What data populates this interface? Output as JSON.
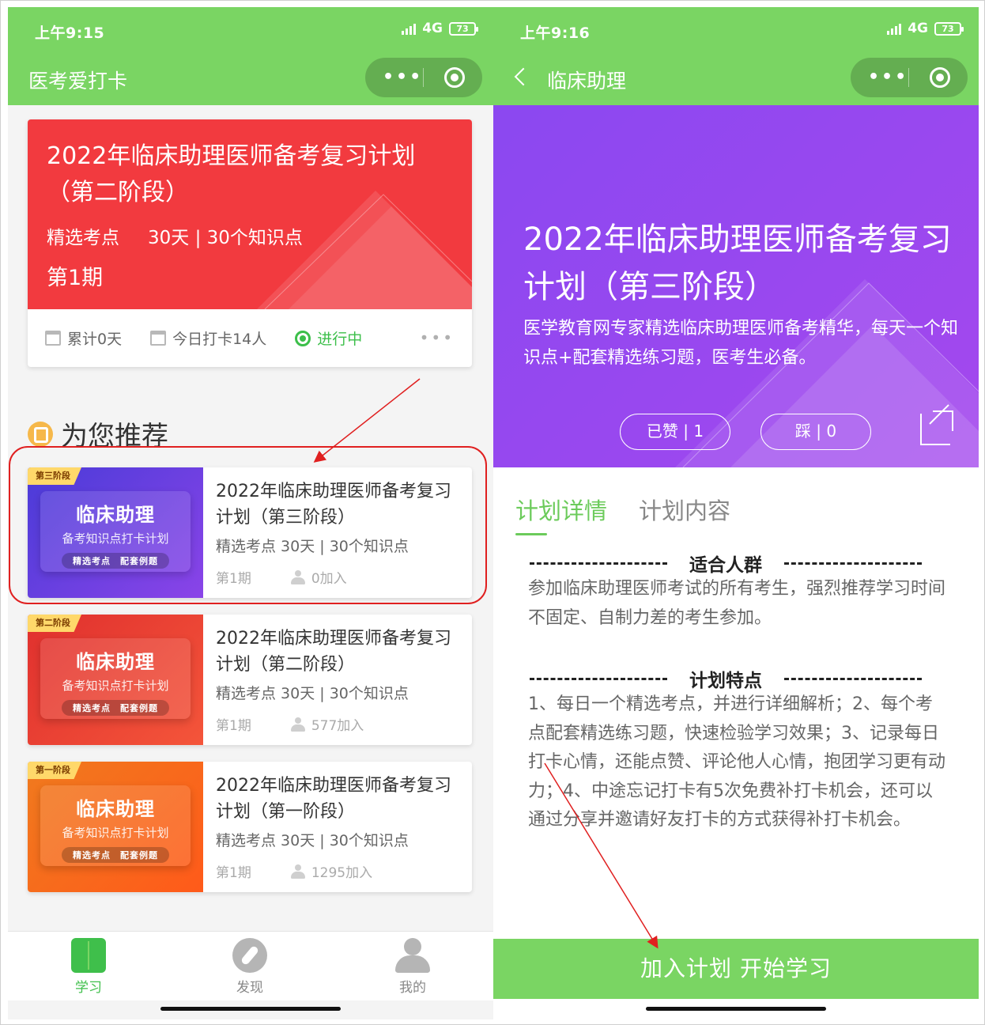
{
  "colors": {
    "wechat_green": "#7ad563",
    "card_red": "#f23a3f",
    "hero_purple": "#8b48f0",
    "active_green": "#3fbf4b",
    "annotation_red": "#e02020"
  },
  "left": {
    "status": {
      "time": "上午9:15",
      "network": "4G",
      "battery": "73"
    },
    "nav": {
      "title": "医考爱打卡"
    },
    "main_card": {
      "title": "2022年临床助理医师备考复习计划（第二阶段）",
      "meta_a": "精选考点",
      "meta_b": "30天 | 30个知识点",
      "period": "第1期",
      "stat_total": "累计0天",
      "stat_today": "今日打卡14人",
      "stat_status": "进行中"
    },
    "recommend": {
      "heading": "为您推荐",
      "items": [
        {
          "stage_tag": "第三阶段",
          "thumb_title": "临床助理",
          "thumb_sub": "备考知识点打卡计划",
          "thumb_pill": "精选考点　配套例题",
          "title": "2022年临床助理医师备考复习计划（第三阶段）",
          "meta": "精选考点  30天 | 30个知识点",
          "period": "第1期",
          "joined": "0加入"
        },
        {
          "stage_tag": "第二阶段",
          "thumb_title": "临床助理",
          "thumb_sub": "备考知识点打卡计划",
          "thumb_pill": "精选考点　配套例题",
          "title": "2022年临床助理医师备考复习计划（第二阶段）",
          "meta": "精选考点  30天 | 30个知识点",
          "period": "第1期",
          "joined": "577加入"
        },
        {
          "stage_tag": "第一阶段",
          "thumb_title": "临床助理",
          "thumb_sub": "备考知识点打卡计划",
          "thumb_pill": "精选考点　配套例题",
          "title": "2022年临床助理医师备考复习计划（第一阶段）",
          "meta": "精选考点  30天 | 30个知识点",
          "period": "第1期",
          "joined": "1295加入"
        }
      ]
    },
    "tabbar": {
      "study": "学习",
      "discover": "发现",
      "me": "我的"
    }
  },
  "right": {
    "status": {
      "time": "上午9:16",
      "network": "4G",
      "battery": "73"
    },
    "nav": {
      "title": "临床助理"
    },
    "hero": {
      "title": "2022年临床助理医师备考复习计划（第三阶段）",
      "desc": "医学教育网专家精选临床助理医师备考精华，每天一个知识点+配套精选练习题，医考生必备。",
      "like": "已赞 | 1",
      "dislike": "踩 | 0"
    },
    "tabs": {
      "details": "计划详情",
      "content": "计划内容"
    },
    "audience": {
      "heading": "适合人群",
      "text": "参加临床助理医师考试的所有考生，强烈推荐学习时间不固定、自制力差的考生参加。"
    },
    "features": {
      "heading": "计划特点",
      "text": "1、每日一个精选考点，并进行详细解析；2、每个考点配套精选练习题，快速检验学习效果；3、记录每日打卡心情，还能点赞、评论他人心情，抱团学习更有动力；4、中途忘记打卡有5次免费补打卡机会，还可以通过分享并邀请好友打卡的方式获得补打卡机会。"
    },
    "join_button": "加入计划 开始学习"
  }
}
